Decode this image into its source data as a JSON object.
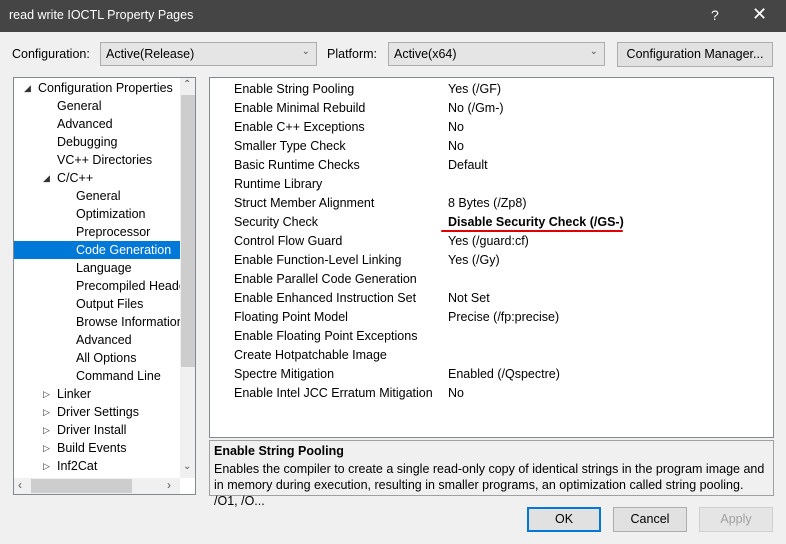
{
  "window": {
    "title": "read write IOCTL Property Pages",
    "help": "?",
    "close": "✕"
  },
  "toolbar": {
    "configuration_label": "Configuration:",
    "configuration_value": "Active(Release)",
    "platform_label": "Platform:",
    "platform_value": "Active(x64)",
    "config_manager": "Configuration Manager..."
  },
  "tree": {
    "items": [
      {
        "label": "Configuration Properties",
        "level": 0,
        "expander": "expanded"
      },
      {
        "label": "General",
        "level": 1
      },
      {
        "label": "Advanced",
        "level": 1
      },
      {
        "label": "Debugging",
        "level": 1
      },
      {
        "label": "VC++ Directories",
        "level": 1
      },
      {
        "label": "C/C++",
        "level": 1,
        "expander": "expanded"
      },
      {
        "label": "General",
        "level": 2
      },
      {
        "label": "Optimization",
        "level": 2
      },
      {
        "label": "Preprocessor",
        "level": 2
      },
      {
        "label": "Code Generation",
        "level": 2,
        "selected": true
      },
      {
        "label": "Language",
        "level": 2
      },
      {
        "label": "Precompiled Headers",
        "level": 2
      },
      {
        "label": "Output Files",
        "level": 2
      },
      {
        "label": "Browse Information",
        "level": 2
      },
      {
        "label": "Advanced",
        "level": 2
      },
      {
        "label": "All Options",
        "level": 2
      },
      {
        "label": "Command Line",
        "level": 2
      },
      {
        "label": "Linker",
        "level": 1,
        "expander": "collapsed"
      },
      {
        "label": "Driver Settings",
        "level": 1,
        "expander": "collapsed"
      },
      {
        "label": "Driver Install",
        "level": 1,
        "expander": "collapsed"
      },
      {
        "label": "Build Events",
        "level": 1,
        "expander": "collapsed"
      },
      {
        "label": "Inf2Cat",
        "level": 1,
        "expander": "collapsed"
      }
    ]
  },
  "properties": [
    {
      "name": "Enable String Pooling",
      "value": "Yes (/GF)"
    },
    {
      "name": "Enable Minimal Rebuild",
      "value": "No (/Gm-)"
    },
    {
      "name": "Enable C++ Exceptions",
      "value": "No"
    },
    {
      "name": "Smaller Type Check",
      "value": "No"
    },
    {
      "name": "Basic Runtime Checks",
      "value": "Default"
    },
    {
      "name": "Runtime Library",
      "value": ""
    },
    {
      "name": "Struct Member Alignment",
      "value": "8 Bytes (/Zp8)"
    },
    {
      "name": "Security Check",
      "value": "Disable Security Check (/GS-)",
      "bold": true,
      "annotated": true
    },
    {
      "name": "Control Flow Guard",
      "value": "Yes (/guard:cf)"
    },
    {
      "name": "Enable Function-Level Linking",
      "value": "Yes (/Gy)"
    },
    {
      "name": "Enable Parallel Code Generation",
      "value": ""
    },
    {
      "name": "Enable Enhanced Instruction Set",
      "value": "Not Set"
    },
    {
      "name": "Floating Point Model",
      "value": "Precise (/fp:precise)"
    },
    {
      "name": "Enable Floating Point Exceptions",
      "value": ""
    },
    {
      "name": "Create Hotpatchable Image",
      "value": ""
    },
    {
      "name": "Spectre Mitigation",
      "value": "Enabled (/Qspectre)"
    },
    {
      "name": "Enable Intel JCC Erratum Mitigation",
      "value": "No"
    }
  ],
  "description": {
    "title": "Enable String Pooling",
    "text": "Enables the compiler to create a single read-only copy of identical strings in the program image and in memory during execution, resulting in smaller programs, an optimization called string pooling. /O1, /O..."
  },
  "buttons": {
    "ok": "OK",
    "cancel": "Cancel",
    "apply": "Apply"
  },
  "colors": {
    "selection": "#0078d7",
    "annotation": "#e00000",
    "titlebar": "#454545"
  }
}
